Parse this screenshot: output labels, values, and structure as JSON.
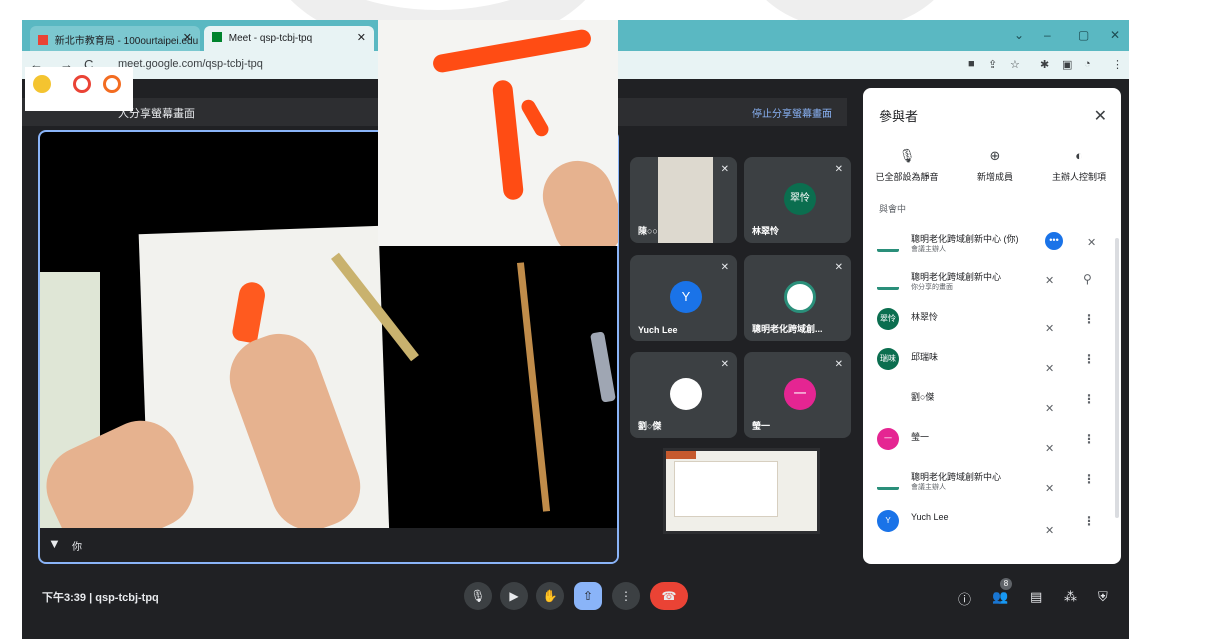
{
  "browser": {
    "tabs": [
      {
        "label": "新北市教育局 - 100ourtaipei.edu"
      },
      {
        "label": "Meet - qsp-tcbj-tpq"
      }
    ],
    "url": "meet.google.com/qsp-tcbj-tpq",
    "window_controls": [
      "⌄",
      "–",
      "▢",
      "✕"
    ]
  },
  "sharing": {
    "banner_text": "人分享螢幕畫面",
    "stop_label": "停止分享螢幕畫面"
  },
  "main": {
    "self_label": "你"
  },
  "tiles": [
    {
      "name": "陳○○",
      "avatar": ""
    },
    {
      "name": "林翠怜",
      "avatar": "翠怜"
    },
    {
      "name": "Yuch Lee",
      "avatar": "Y"
    },
    {
      "name": "聰明老化跨域創...",
      "avatar": ""
    },
    {
      "name": "劉○傑",
      "avatar": ""
    },
    {
      "name": "瑩一",
      "avatar": "一"
    }
  ],
  "toolbar": {
    "time": "下午3:39",
    "meeting_code": "qsp-tcbj-tpq",
    "people_count": "8"
  },
  "panel": {
    "title": "參與者",
    "actions": [
      "已全部設為靜音",
      "新增成員",
      "主辦人控制項"
    ],
    "section": "與會中",
    "participants": [
      {
        "name": "聰明老化跨域創新中心 (你)",
        "sub": "會議主辦人",
        "avatar": "",
        "color": "#2a8f7a"
      },
      {
        "name": "聰明老化跨域創新中心",
        "sub": "你分享的畫面",
        "avatar": "",
        "color": "#2a8f7a"
      },
      {
        "name": "林翠怜",
        "sub": "",
        "avatar": "翠怜",
        "color": "#0b6e4f"
      },
      {
        "name": "邱瑞味",
        "sub": "",
        "avatar": "瑞味",
        "color": "#0b6e4f"
      },
      {
        "name": "劉○傑",
        "sub": "",
        "avatar": "",
        "color": "#3c4043"
      },
      {
        "name": "瑩一",
        "sub": "",
        "avatar": "一",
        "color": "#e52592"
      },
      {
        "name": "聰明老化跨域創新中心",
        "sub": "會議主辦人",
        "avatar": "",
        "color": "#2a8f7a"
      },
      {
        "name": "Yuch Lee",
        "sub": "",
        "avatar": "Y",
        "color": "#1a73e8"
      }
    ]
  },
  "colors": {
    "tab_bar": "#5ab8c2",
    "meet_dark": "#202124",
    "accent_blue": "#8ab4f8",
    "hangup_red": "#ea4335",
    "brush_red": "#ff4c14"
  }
}
